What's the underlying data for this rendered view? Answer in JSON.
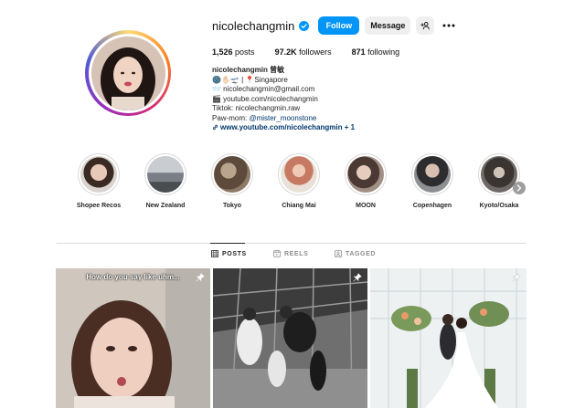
{
  "profile": {
    "username": "nicolechangmin",
    "follow_label": "Follow",
    "message_label": "Message",
    "stats": {
      "posts_count": "1,526",
      "posts_label": "posts",
      "followers_count": "97.2K",
      "followers_label": "followers",
      "following_count": "871",
      "following_label": "following"
    },
    "bio": {
      "name": "nicolechangmin 曾敏",
      "line1": "🌚✋🏻🛫 | 📍Singapore",
      "line2": "📨 nicolechangmin@gmail.com",
      "line3": "🎬 youtube.com/nicolechangmin",
      "line4": "Tiktok: nicolechangmin.raw",
      "line5_prefix": "Paw-mom: ",
      "line5_mention": "@mister_moonstone",
      "link": "www.youtube.com/nicolechangmin + 1"
    }
  },
  "highlights": [
    {
      "label": "Shopee Recos"
    },
    {
      "label": "New Zealand"
    },
    {
      "label": "Tokyo"
    },
    {
      "label": "Chiang Mai"
    },
    {
      "label": "MOON"
    },
    {
      "label": "Copenhagen"
    },
    {
      "label": "Kyoto/Osaka"
    }
  ],
  "tabs": {
    "posts": "POSTS",
    "reels": "REELS",
    "tagged": "TAGGED"
  },
  "posts": [
    {
      "caption": "How do you say like uhm..."
    }
  ],
  "colors": {
    "accent": "#0095f6",
    "link": "#00376b",
    "secondary_button": "#efefef"
  },
  "icons": [
    "verified-badge-icon",
    "add-user-icon",
    "more-options-icon",
    "chevron-right-icon",
    "grid-icon",
    "reels-icon",
    "tagged-icon",
    "pin-icon"
  ]
}
